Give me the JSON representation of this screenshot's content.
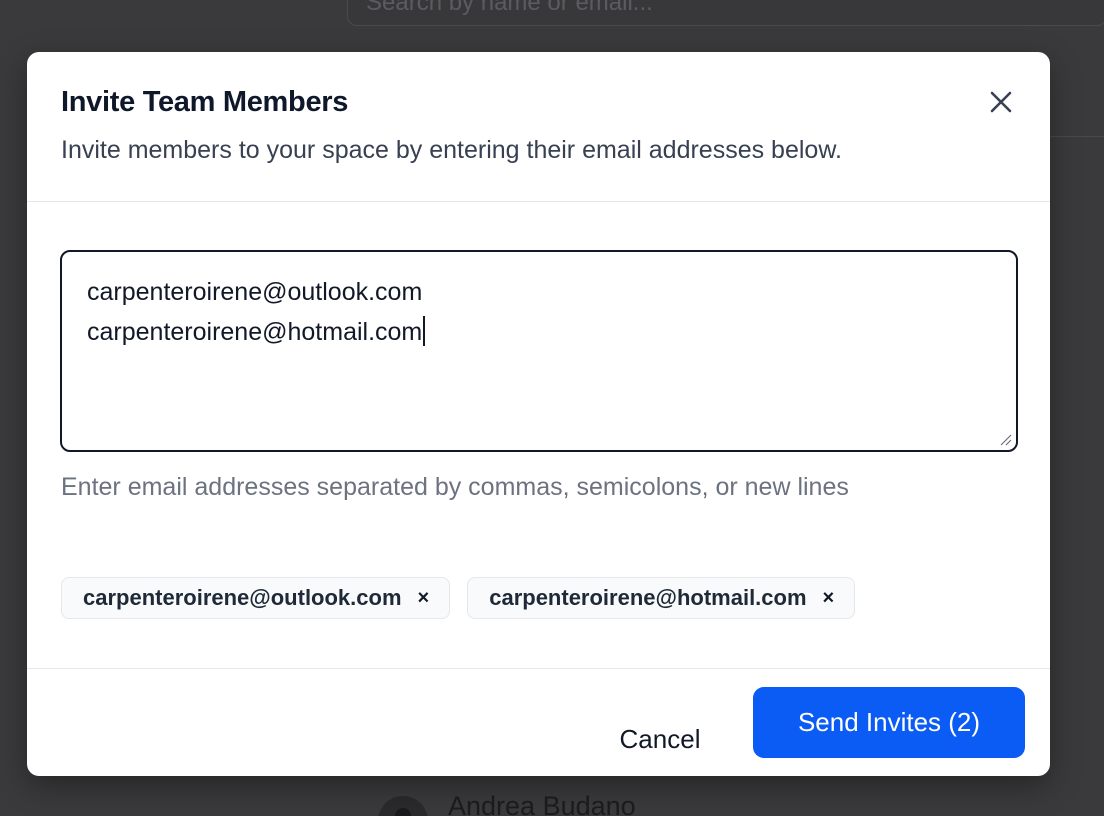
{
  "background": {
    "search_placeholder": "Search by name or email...",
    "member_name": "Andrea Budano"
  },
  "modal": {
    "title": "Invite Team Members",
    "subtitle": "Invite members to your space by entering their email addresses below.",
    "close_icon": "close-icon",
    "textarea": {
      "lines": [
        "carpenteroirene@outlook.com",
        "carpenteroirene@hotmail.com"
      ]
    },
    "helper_text": "Enter email addresses separated by commas, semicolons, or new lines",
    "chips": [
      {
        "label": "carpenteroirene@outlook.com",
        "remove": "×"
      },
      {
        "label": "carpenteroirene@hotmail.com",
        "remove": "×"
      }
    ],
    "footer": {
      "cancel_label": "Cancel",
      "send_label": "Send Invites (2)"
    }
  },
  "colors": {
    "accent": "#0a5cf5",
    "overlay": "#3a3a3c",
    "title": "#0f172a",
    "muted": "#6b7280"
  }
}
